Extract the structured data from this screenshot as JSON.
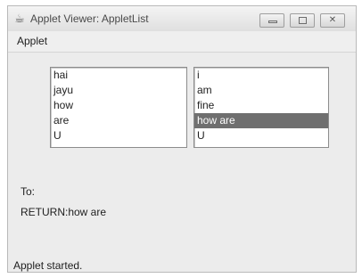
{
  "window": {
    "title": "Applet Viewer: AppletList",
    "buttons": {
      "minimize": "minimize",
      "maximize": "maximize",
      "close": "close"
    }
  },
  "menu": {
    "items": [
      "Applet"
    ]
  },
  "applet": {
    "left_list": {
      "items": [
        "hai",
        "jayu",
        "how",
        "are",
        "U"
      ]
    },
    "right_list": {
      "items": [
        "i",
        "am",
        "fine",
        "how are",
        "U"
      ],
      "selected_index": 3
    },
    "to_label": "To:",
    "return_label": "RETURN:how are"
  },
  "status": {
    "text": "Applet started."
  },
  "icons": {
    "app": "applet-viewer-icon",
    "minimize": "minimize-icon",
    "maximize": "maximize-icon",
    "close": "close-icon"
  },
  "colors": {
    "selection": "#6f6f6f",
    "window": "#e9e9e9"
  }
}
